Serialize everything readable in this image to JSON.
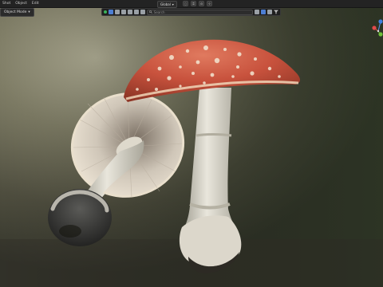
{
  "menubar": {
    "items": [
      "Shot",
      "Object",
      "Edit"
    ]
  },
  "mode_select": {
    "label": "Object Mode",
    "caret": "▾"
  },
  "shading": {
    "label": "Global",
    "caret": "▾"
  },
  "search": {
    "placeholder": "Search"
  },
  "icons": {
    "search": "magnifier-icon",
    "filter": "funnel-icon",
    "gizmo": "navigation-gizmo-icon"
  },
  "colors": {
    "menubar_bg": "#232323",
    "accent": "#4d7fd4",
    "cap": "#c8523d",
    "gizmo_x": "#e24a4a",
    "gizmo_y": "#6fbf3a",
    "gizmo_z": "#3f7fe0"
  }
}
